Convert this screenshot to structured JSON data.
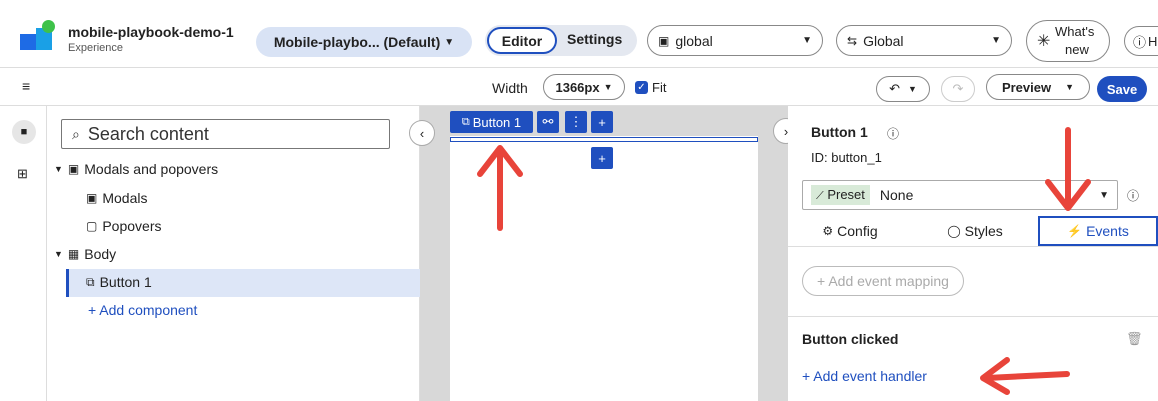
{
  "header": {
    "app_name": "mobile-playbook-demo-1",
    "app_sub": "Experience",
    "page_selector": "Mobile-playbo... (Default)",
    "mode_editor": "Editor",
    "mode_settings": "Settings",
    "scope_dropdown": "global",
    "locale_dropdown": "Global",
    "whats_new_line1": "What's",
    "whats_new_line2": "new",
    "help_label": "H"
  },
  "toolbar": {
    "width_label": "Width",
    "width_value": "1366px",
    "fit_label": "Fit",
    "preview_label": "Preview",
    "save_label": "Save"
  },
  "left": {
    "search_placeholder": "Search content",
    "tree": [
      {
        "label": "Modals and popovers"
      },
      {
        "label": "Modals"
      },
      {
        "label": "Popovers"
      },
      {
        "label": "Body"
      },
      {
        "label": "Button 1"
      }
    ],
    "add_component": "+ Add component"
  },
  "canvas": {
    "chip_label": "Button 1"
  },
  "right": {
    "title": "Button 1",
    "id_label": "ID: button_1",
    "preset_badge": "Preset",
    "preset_value": "None",
    "tab_config": "Config",
    "tab_styles": "Styles",
    "tab_events": "Events",
    "add_event_mapping": "+ Add event mapping",
    "section_title": "Button clicked",
    "add_event_handler": "+ Add event handler"
  },
  "colors": {
    "accent": "#1f4fbf",
    "arrow": "#e8443a"
  }
}
